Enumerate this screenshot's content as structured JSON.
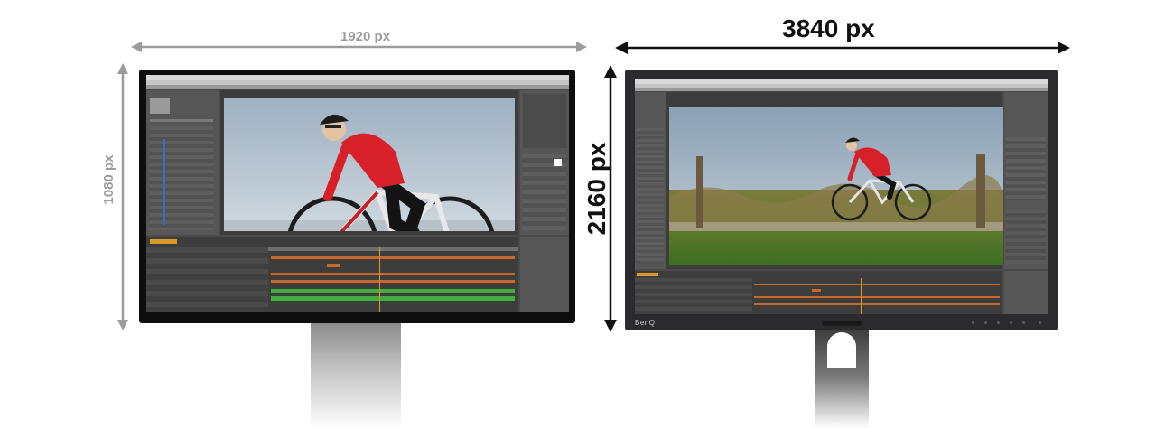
{
  "left_display": {
    "width_label": "1920 px",
    "height_label": "1080 px"
  },
  "right_display": {
    "width_label": "3840 px",
    "height_label": "2160 px",
    "brand": "BenQ"
  },
  "colors": {
    "label_small": "#9c9c9c",
    "label_large": "#111111",
    "jersey": "#d8202a",
    "timeline_orange": "#c8682a",
    "timeline_green": "#3fae3c"
  }
}
